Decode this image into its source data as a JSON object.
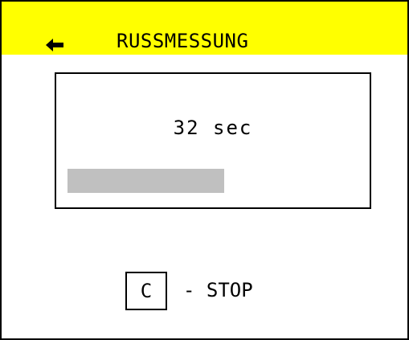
{
  "colors": {
    "header_background": "#ffff00",
    "progress_fill": "#c0c0c0",
    "foreground": "#000000",
    "background": "#ffffff"
  },
  "header": {
    "back_icon": "left-arrow-icon",
    "title": "RUSSMESSUNG"
  },
  "measurement": {
    "timer_text": "32 sec",
    "progress_fraction": 0.54
  },
  "footer": {
    "key_label": "C",
    "action_label": "- STOP"
  }
}
